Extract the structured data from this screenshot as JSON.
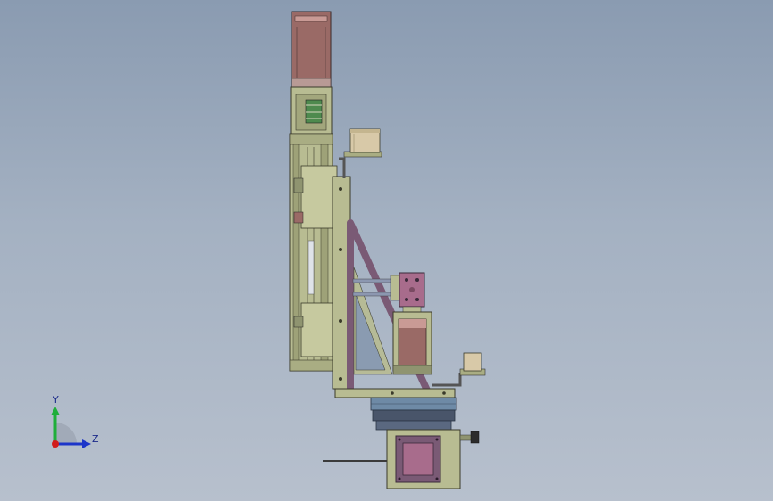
{
  "triad": {
    "y_label": "Y",
    "z_label": "Z"
  },
  "colors": {
    "background_top": "#8a9bb1",
    "background_bottom": "#b7c0cd",
    "olive_part": "#b8bc92",
    "olive_dark": "#8f9470",
    "motor_body": "#9a6a66",
    "motor_light": "#c99a95",
    "bracket_purple": "#7a5a75",
    "magenta_block": "#a86c8c",
    "base_dark": "#49556a",
    "base_blue": "#6e8aa6",
    "cup_tan": "#d8c9a8",
    "axis_y": "#1fae3a",
    "axis_z": "#1d35c9",
    "origin_red": "#d11c1c"
  }
}
